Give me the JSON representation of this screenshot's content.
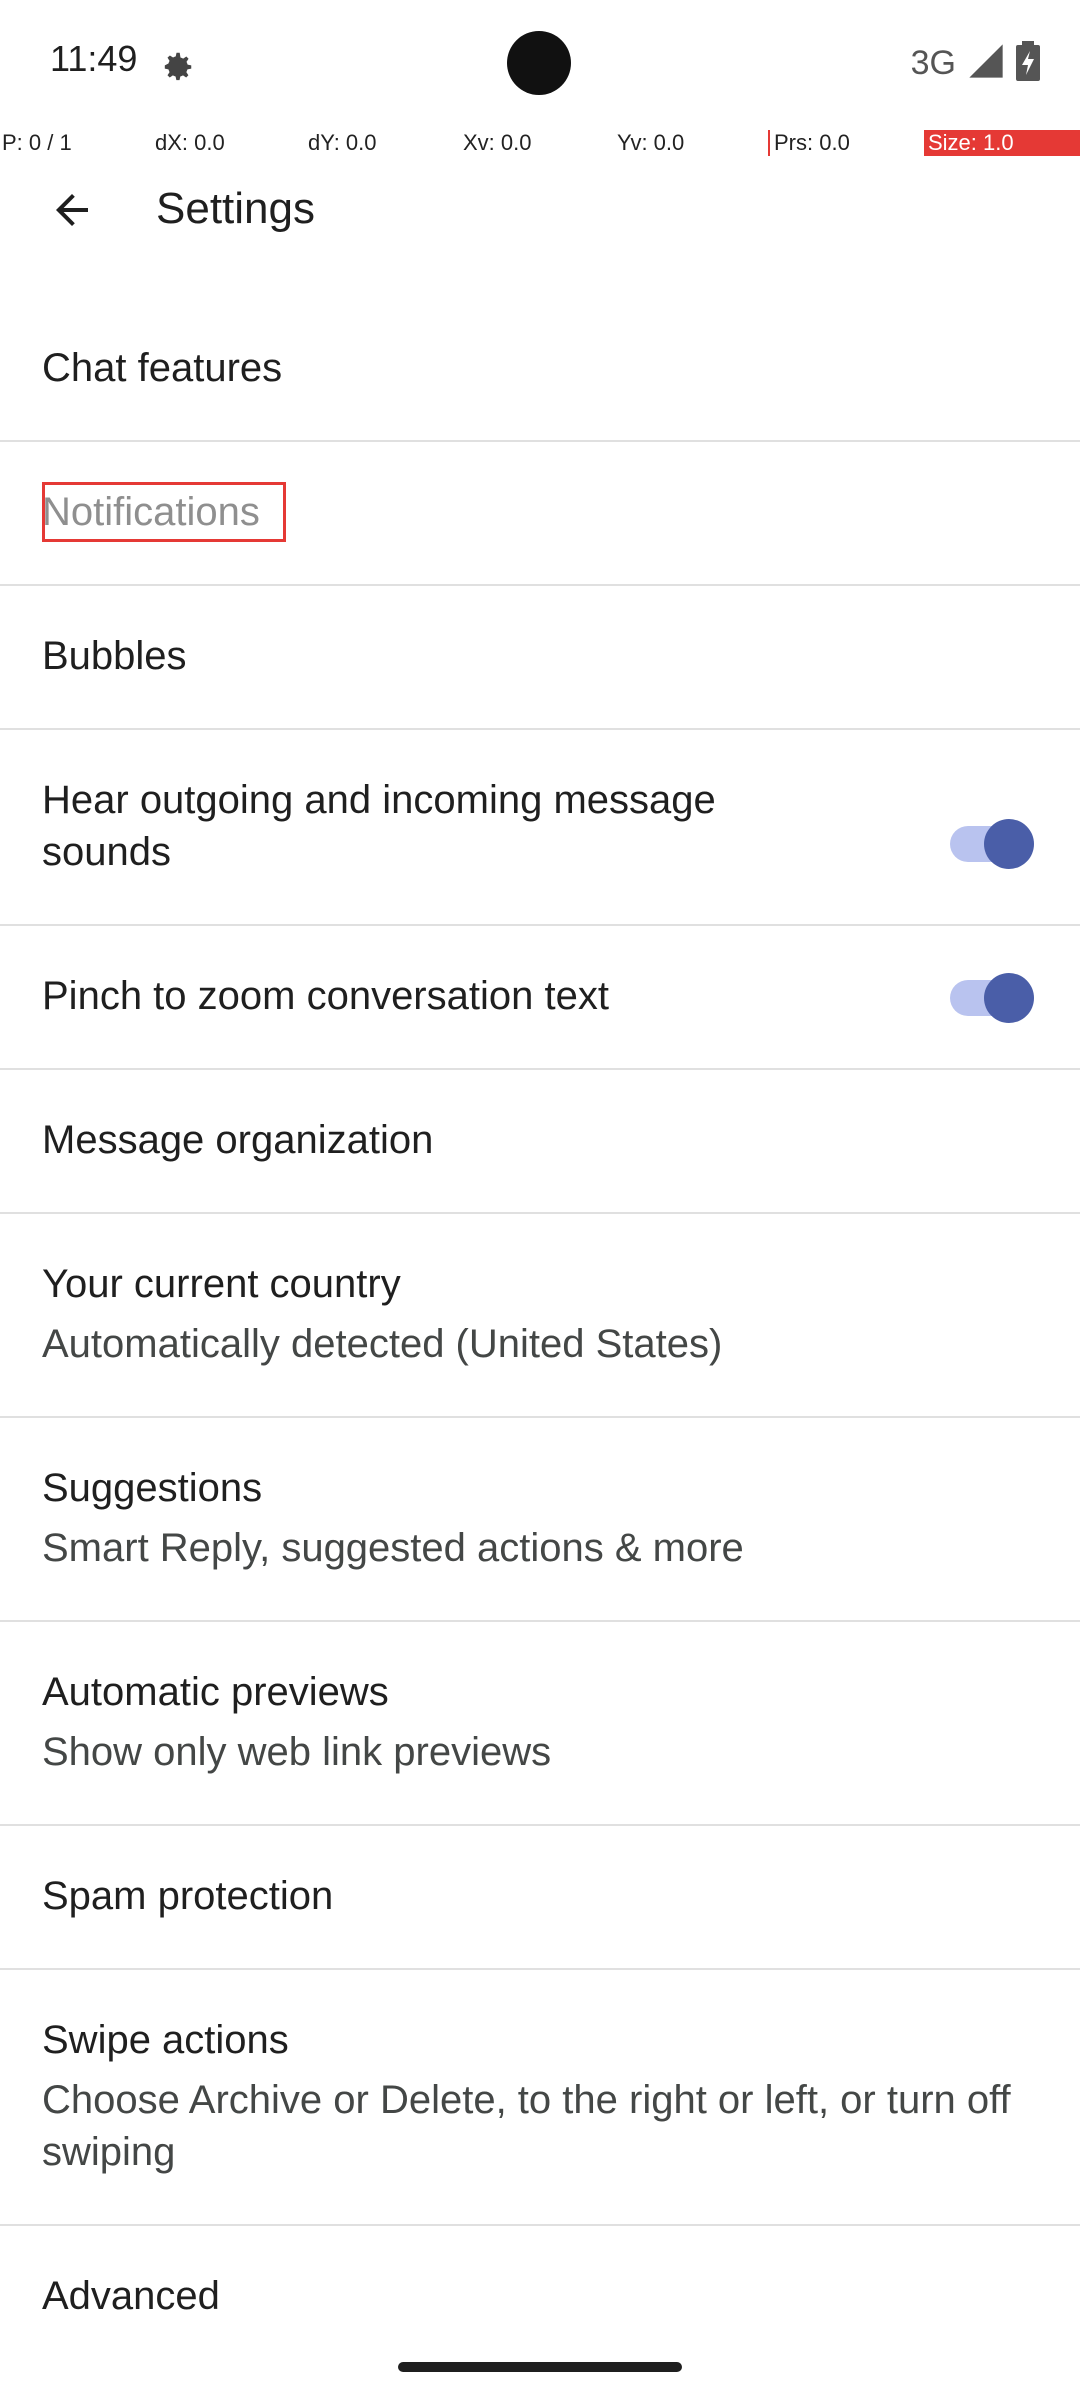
{
  "status_bar": {
    "time": "11:49",
    "network": "3G",
    "icons": [
      "settings-gear-icon",
      "signal-icon",
      "battery-icon"
    ]
  },
  "debug_overlay": {
    "pointer": "P: 0 / 1",
    "dx": "dX: 0.0",
    "dy": "dY: 0.0",
    "xv": "Xv: 0.0",
    "yv": "Yv: 0.0",
    "prs": "Prs: 0.0",
    "size": "Size: 1.0"
  },
  "toolbar": {
    "back_icon": "arrow-back-icon",
    "title": "Settings"
  },
  "settings": {
    "chat_features": {
      "title": "Chat features"
    },
    "notifications": {
      "title": "Notifications"
    },
    "bubbles": {
      "title": "Bubbles"
    },
    "sounds": {
      "title": "Hear outgoing and incoming message sounds",
      "enabled": true
    },
    "pinch_zoom": {
      "title": "Pinch to zoom conversation text",
      "enabled": true
    },
    "message_organization": {
      "title": "Message organization"
    },
    "country": {
      "title": "Your current country",
      "subtitle": "Automatically detected (United States)"
    },
    "suggestions": {
      "title": "Suggestions",
      "subtitle": "Smart Reply, suggested actions & more"
    },
    "previews": {
      "title": "Automatic previews",
      "subtitle": "Show only web link previews"
    },
    "spam": {
      "title": "Spam protection"
    },
    "swipe": {
      "title": "Swipe actions",
      "subtitle": "Choose Archive or Delete, to the right or left, or turn off swiping"
    },
    "advanced": {
      "title": "Advanced"
    }
  },
  "colors": {
    "toggle_track": "#b9c3ef",
    "toggle_knob": "#4a5ea8",
    "highlight": "#e53935"
  }
}
